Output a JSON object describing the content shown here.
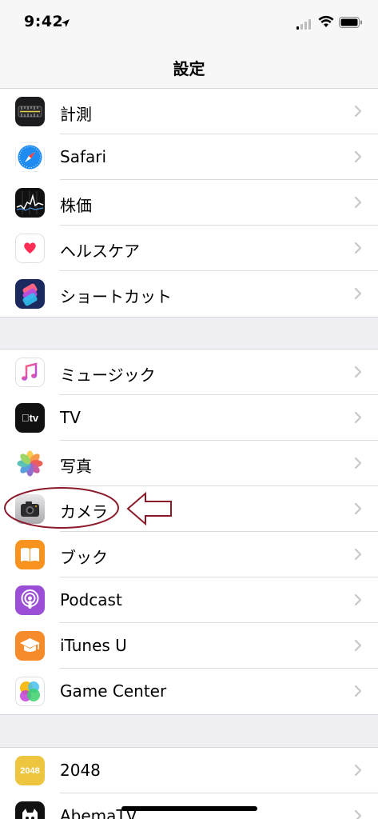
{
  "status_bar": {
    "time": "9:42"
  },
  "nav": {
    "title": "設定"
  },
  "groups": [
    {
      "items": [
        {
          "label": "計測",
          "icon": "measure-icon"
        },
        {
          "label": "Safari",
          "icon": "safari-icon"
        },
        {
          "label": "株価",
          "icon": "stocks-icon"
        },
        {
          "label": "ヘルスケア",
          "icon": "health-icon"
        },
        {
          "label": "ショートカット",
          "icon": "shortcuts-icon"
        }
      ]
    },
    {
      "items": [
        {
          "label": "ミュージック",
          "icon": "music-icon"
        },
        {
          "label": "TV",
          "icon": "tv-icon",
          "icon_text": "tv"
        },
        {
          "label": "写真",
          "icon": "photos-icon"
        },
        {
          "label": "カメラ",
          "icon": "camera-icon"
        },
        {
          "label": "ブック",
          "icon": "books-icon"
        },
        {
          "label": "Podcast",
          "icon": "podcast-icon"
        },
        {
          "label": "iTunes U",
          "icon": "itunes-u-icon"
        },
        {
          "label": "Game Center",
          "icon": "game-center-icon"
        }
      ]
    },
    {
      "items": [
        {
          "label": "2048",
          "icon": "app-2048-icon",
          "icon_text": "2048"
        },
        {
          "label": "AbemaTV",
          "icon": "abematv-icon"
        }
      ]
    }
  ],
  "colors": {
    "background": "#efeff4",
    "annotation": "#8b1a2b",
    "chevron": "#c7c7cc"
  }
}
